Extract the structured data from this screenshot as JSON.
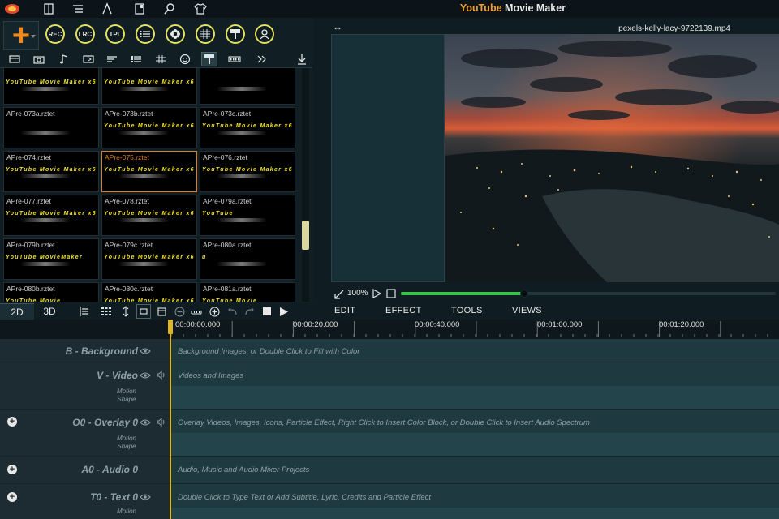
{
  "titlebar": {
    "title_part1": "YouTube",
    "title_part2": "Movie Maker",
    "icons": [
      "app-logo-icon",
      "book-icon",
      "list-icon",
      "pen-icon",
      "layout-icon",
      "search-icon",
      "shirt-icon"
    ]
  },
  "toolbar_top": {
    "add_button": "+",
    "round_buttons": [
      "REC",
      "LRC",
      "TPL"
    ],
    "icon_buttons": [
      "list-icon",
      "flower-icon",
      "music-grid-icon",
      "text-template-icon",
      "user-icon"
    ]
  },
  "library_tabs": [
    "film-icon",
    "camera-icon",
    "music-icon",
    "transition-icon",
    "subtitle-icon",
    "list-icon",
    "spectrum-icon",
    "emoji-icon",
    "text-template-icon",
    "progress-icon",
    "more-icon",
    "download-icon"
  ],
  "tiles": [
    {
      "name": "",
      "preview": "YouTube Movie Maker x6",
      "partial": true
    },
    {
      "name": "",
      "preview": "YouTube Movie Maker x6",
      "partial": true
    },
    {
      "name": "",
      "preview": "",
      "partial": true
    },
    {
      "name": "APre-073a.rztet",
      "preview": ""
    },
    {
      "name": "APre-073b.rztet",
      "preview": "YouTube Movie Maker x6"
    },
    {
      "name": "APre-073c.rztet",
      "preview": "YouTube Movie Maker x6"
    },
    {
      "name": "APre-074.rztet",
      "preview": "YouTube Movie Maker x6"
    },
    {
      "name": "APre-075.rztet",
      "preview": "YouTube Movie Maker x6",
      "selected": true
    },
    {
      "name": "APre-076.rztet",
      "preview": "YouTube Movie Maker x6"
    },
    {
      "name": "APre-077.rztet",
      "preview": "YouTube Movie Maker x6"
    },
    {
      "name": "APre-078.rztet",
      "preview": "YouTube Movie Maker x6"
    },
    {
      "name": "APre-079a.rztet",
      "preview": "YouTube"
    },
    {
      "name": "APre-079b.rztet",
      "preview": "YouTube MovieMaker"
    },
    {
      "name": "APre-079c.rztet",
      "preview": "YouTube Movie Maker x6"
    },
    {
      "name": "APre-080a.rztet",
      "preview": "u"
    },
    {
      "name": "APre-080b.rztet",
      "preview": "YouTube Movie"
    },
    {
      "name": "APre-080c.rztet",
      "preview": "YouTube Movie Maker x6"
    },
    {
      "name": "APre-081a.rztet",
      "preview": "YouTube Movie"
    }
  ],
  "preview": {
    "filename": "pexels-kelly-lacy-9722139.mp4",
    "expand_icon": "↔",
    "zoom": "100%",
    "progress": 0.33
  },
  "toolrow": {
    "tab_2d": "2D",
    "tab_3d": "3D",
    "menu": [
      "EDIT",
      "EFFECT",
      "TOOLS",
      "VIEWS"
    ]
  },
  "ruler": [
    "00:00:00.000",
    "00:00:20.000",
    "00:00:40.000",
    "00:01:00.000",
    "00:01:20.000"
  ],
  "tracks": [
    {
      "label": "B - Background",
      "hint": "Background Images, or Double Click to Fill with Color"
    },
    {
      "label": "V - Video",
      "hint": "Videos and Images",
      "sub": [
        "Motion",
        "Shape"
      ]
    },
    {
      "label": "O0 - Overlay 0",
      "hint": "Overlay Videos, Images, Icons, Particle Effect, Right Click to Insert Color Block, or Double Click to Insert Audio Spectrum",
      "sub": [
        "Motion",
        "Shape"
      ]
    },
    {
      "label": "A0 - Audio 0",
      "hint": "Audio, Music and Audio Mixer Projects"
    },
    {
      "label": "T0 - Text 0",
      "hint": "Double Click to Type Text or Add Subtitle, Lyric, Credits and Particle Effect",
      "sub": [
        "Motion"
      ]
    }
  ]
}
